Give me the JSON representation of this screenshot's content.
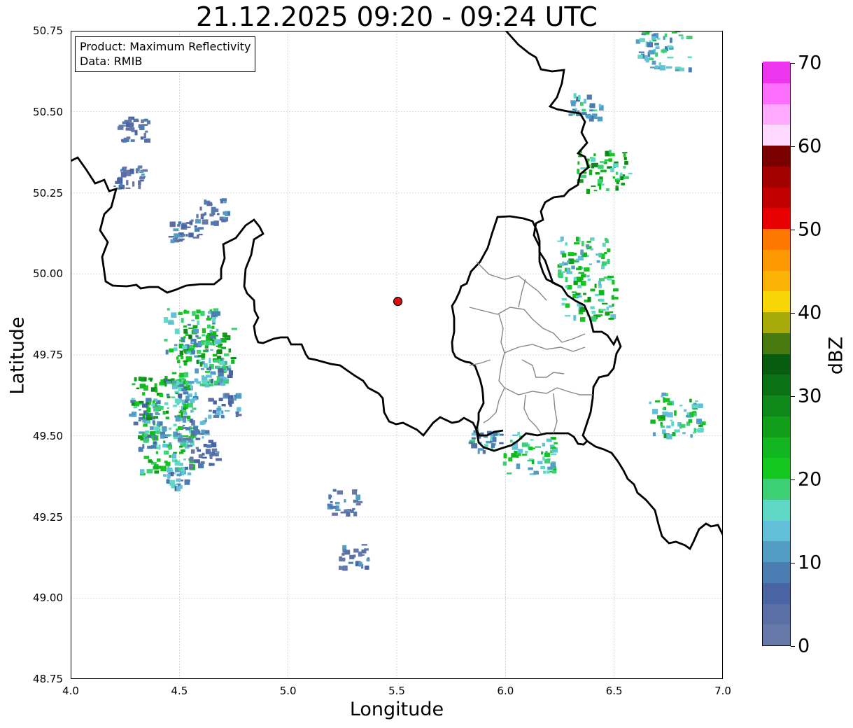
{
  "title": "21.12.2025 09:20 - 09:24 UTC",
  "xlabel": "Longitude",
  "ylabel": "Latitude",
  "info": {
    "product": "Product: Maximum Reflectivity",
    "data": "Data: RMIB"
  },
  "colorbar": {
    "label": "dBZ",
    "min": 0,
    "max": 70,
    "ticks": [
      "0",
      "10",
      "20",
      "30",
      "40",
      "50",
      "60",
      "70"
    ],
    "colors": [
      "#6678a8",
      "#5a6fa6",
      "#4a63a2",
      "#4b7db3",
      "#539cc4",
      "#62c0d9",
      "#5fd9c6",
      "#3ccf73",
      "#14c71e",
      "#12b620",
      "#119f1a",
      "#10891b",
      "#0b7316",
      "#075c10",
      "#487a10",
      "#a8aa0a",
      "#f7d507",
      "#fbb405",
      "#fe9903",
      "#fe7800",
      "#e80000",
      "#c20000",
      "#a30000",
      "#7a0000",
      "#ffd9ff",
      "#ffaaff",
      "#ff6fff",
      "#ec35ec"
    ]
  },
  "chart_data": {
    "type": "map",
    "xlim": [
      4.0,
      7.0
    ],
    "ylim": [
      48.75,
      50.75
    ],
    "xticks": [
      "4.0",
      "4.5",
      "5.0",
      "5.5",
      "6.0",
      "6.5",
      "7.0"
    ],
    "yticks": [
      "48.75",
      "49.00",
      "49.25",
      "49.50",
      "49.75",
      "50.00",
      "50.25",
      "50.50",
      "50.75"
    ],
    "grid": true,
    "radar_site": {
      "lon": 5.505,
      "lat": 49.915,
      "color": "#dd1111"
    },
    "reflectivity_cells": [
      {
        "lon": 4.48,
        "lat": 49.38,
        "dbz": 12
      },
      {
        "lon": 4.43,
        "lat": 49.45,
        "dbz": 22
      },
      {
        "lon": 4.38,
        "lat": 49.5,
        "dbz": 15
      },
      {
        "lon": 4.45,
        "lat": 49.55,
        "dbz": 18
      },
      {
        "lon": 4.33,
        "lat": 49.58,
        "dbz": 10
      },
      {
        "lon": 4.4,
        "lat": 49.62,
        "dbz": 24
      },
      {
        "lon": 4.5,
        "lat": 49.64,
        "dbz": 12
      },
      {
        "lon": 4.58,
        "lat": 49.72,
        "dbz": 20
      },
      {
        "lon": 4.62,
        "lat": 49.78,
        "dbz": 26
      },
      {
        "lon": 4.55,
        "lat": 49.83,
        "dbz": 16
      },
      {
        "lon": 4.66,
        "lat": 49.7,
        "dbz": 14
      },
      {
        "lon": 4.7,
        "lat": 49.6,
        "dbz": 9
      },
      {
        "lon": 4.55,
        "lat": 49.53,
        "dbz": 8
      },
      {
        "lon": 4.6,
        "lat": 49.45,
        "dbz": 7
      },
      {
        "lon": 4.26,
        "lat": 50.3,
        "dbz": 6
      },
      {
        "lon": 4.28,
        "lat": 50.45,
        "dbz": 5
      },
      {
        "lon": 4.52,
        "lat": 50.13,
        "dbz": 5
      },
      {
        "lon": 4.64,
        "lat": 50.2,
        "dbz": 6
      },
      {
        "lon": 6.35,
        "lat": 50.05,
        "dbz": 20
      },
      {
        "lon": 6.38,
        "lat": 49.93,
        "dbz": 22
      },
      {
        "lon": 6.45,
        "lat": 50.32,
        "dbz": 24
      },
      {
        "lon": 6.36,
        "lat": 50.52,
        "dbz": 14
      },
      {
        "lon": 6.1,
        "lat": 49.45,
        "dbz": 20
      },
      {
        "lon": 5.9,
        "lat": 49.49,
        "dbz": 12
      },
      {
        "lon": 5.3,
        "lat": 49.13,
        "dbz": 6
      },
      {
        "lon": 5.25,
        "lat": 49.3,
        "dbz": 7
      },
      {
        "lon": 6.72,
        "lat": 50.7,
        "dbz": 16
      },
      {
        "lon": 6.78,
        "lat": 49.57,
        "dbz": 20
      }
    ]
  }
}
